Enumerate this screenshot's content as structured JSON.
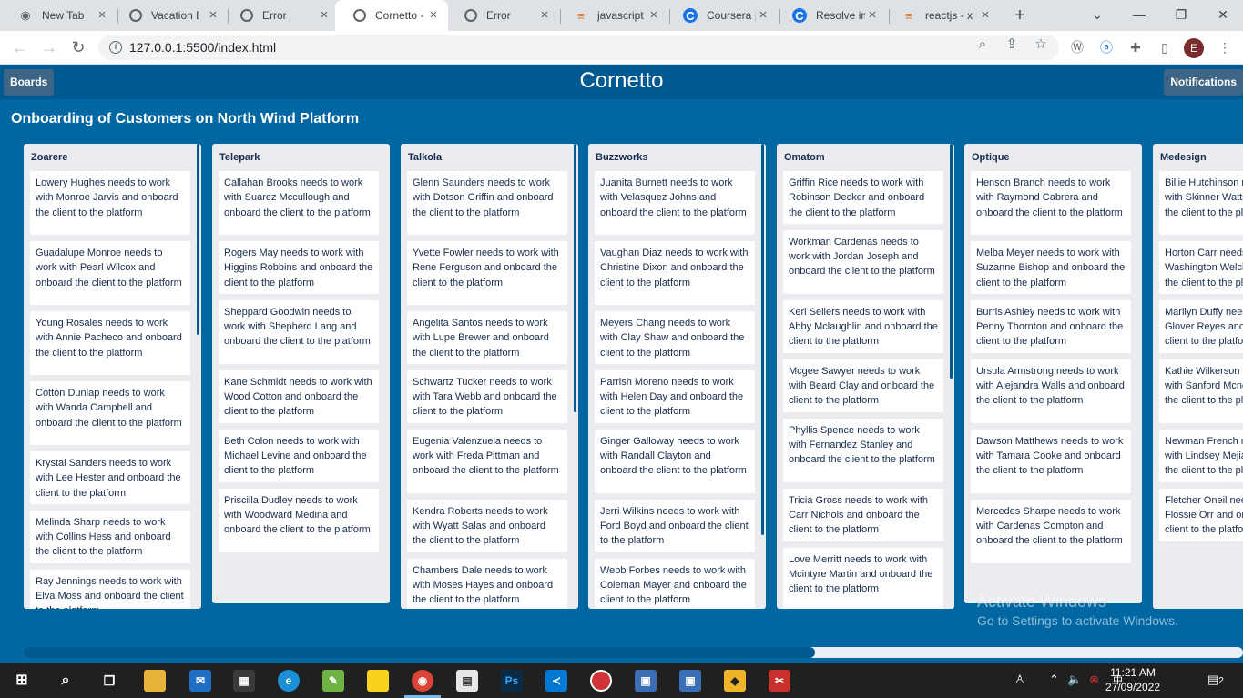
{
  "browser": {
    "tabs": [
      {
        "label": "New Tab",
        "favicon": "chrome-icon"
      },
      {
        "label": "Vacation D",
        "favicon": "globe-icon"
      },
      {
        "label": "Error",
        "favicon": "globe-icon"
      },
      {
        "label": "Cornetto -",
        "favicon": "globe-icon"
      },
      {
        "label": "Error",
        "favicon": "globe-icon"
      },
      {
        "label": "javascript -",
        "favicon": "stackoverflow-icon"
      },
      {
        "label": "Coursera |",
        "favicon": "coursera-icon"
      },
      {
        "label": "Resolve im",
        "favicon": "coursera-icon"
      },
      {
        "label": "reactjs - x",
        "favicon": "stackoverflow-icon"
      }
    ],
    "url": "127.0.0.1:5500/index.html",
    "profile_initial": "E"
  },
  "app": {
    "title": "Cornetto",
    "boards_button": "Boards",
    "notifications_button": "Notifications",
    "board_title": "Onboarding of Customers on North Wind Platform",
    "lists": [
      {
        "title": "Zoarere",
        "cards": [
          "Lowery Hughes needs to work with Monroe Jarvis and onboard the client to the platform",
          "Guadalupe Monroe needs to work with Pearl Wilcox and onboard the client to the platform",
          "Young Rosales needs to work with Annie Pacheco and onboard the client to the platform",
          "Cotton Dunlap needs to work with Wanda Campbell and onboard the client to the platform",
          "Krystal Sanders needs to work with Lee Hester and onboard the client to the platform",
          "Melinda Sharp needs to work with Collins Hess and onboard the client to the platform",
          "Ray Jennings needs to work with Elva Moss and onboard the client to the platform"
        ]
      },
      {
        "title": "Telepark",
        "cards": [
          "Callahan Brooks needs to work with Suarez Mccullough and onboard the client to the platform",
          "Rogers May needs to work with Higgins Robbins and onboard the client to the platform",
          "Sheppard Goodwin needs to work with Shepherd Lang and onboard the client to the platform",
          "Kane Schmidt needs to work with Wood Cotton and onboard the client to the platform",
          "Beth Colon needs to work with Michael Levine and onboard the client to the platform",
          "Priscilla Dudley needs to work with Woodward Medina and onboard the client to the platform"
        ]
      },
      {
        "title": "Talkola",
        "cards": [
          "Glenn Saunders needs to work with Dotson Griffin and onboard the client to the platform",
          "Yvette Fowler needs to work with Rene Ferguson and onboard the client to the platform",
          "Angelita Santos needs to work with Lupe Brewer and onboard the client to the platform",
          "Schwartz Tucker needs to work with Tara Webb and onboard the client to the platform",
          "Eugenia Valenzuela needs to work with Freda Pittman and onboard the client to the platform",
          "Kendra Roberts needs to work with Wyatt Salas and onboard the client to the platform",
          "Chambers Dale needs to work with Moses Hayes and onboard the client to the platform"
        ]
      },
      {
        "title": "Buzzworks",
        "cards": [
          "Juanita Burnett needs to work with Velasquez Johns and onboard the client to the platform",
          "Vaughan Diaz needs to work with Christine Dixon and onboard the client to the platform",
          "Meyers Chang needs to work with Clay Shaw and onboard the client to the platform",
          "Parrish Moreno needs to work with Helen Day and onboard the client to the platform",
          "Ginger Galloway needs to work with Randall Clayton and onboard the client to the platform",
          "Jerri Wilkins needs to work with Ford Boyd and onboard the client to the platform",
          "Webb Forbes needs to work with Coleman Mayer and onboard the client to the platform"
        ]
      },
      {
        "title": "Omatom",
        "cards": [
          "Griffin Rice needs to work with Robinson Decker and onboard the client to the platform",
          "Workman Cardenas needs to work with Jordan Joseph and onboard the client to the platform",
          "Keri Sellers needs to work with Abby Mclaughlin and onboard the client to the platform",
          "Mcgee Sawyer needs to work with Beard Clay and onboard the client to the platform",
          "Phyllis Spence needs to work with Fernandez Stanley and onboard the client to the platform",
          "Tricia Gross needs to work with Carr Nichols and onboard the client to the platform",
          "Love Merritt needs to work with Mcintyre Martin and onboard the client to the platform"
        ]
      },
      {
        "title": "Optique",
        "cards": [
          "Henson Branch needs to work with Raymond Cabrera and onboard the client to the platform",
          "Melba Meyer needs to work with Suzanne Bishop and onboard the client to the platform",
          "Burris Ashley needs to work with Penny Thornton and onboard the client to the platform",
          "Ursula Armstrong needs to work with Alejandra Walls and onboard the client to the platform",
          "Dawson Matthews needs to work with Tamara Cooke and onboard the client to the platform",
          "Mercedes Sharpe needs to work with Cardenas Compton and onboard the client to the platform"
        ]
      },
      {
        "title": "Medesign",
        "cards": [
          "Billie Hutchinson needs to work with Skinner Watts and onboard the client to the platform",
          "Horton Carr needs to work with Washington Welch and onboard the client to the platform",
          "Marilyn Duffy needs to work with Glover Reyes and onboard the client to the platform",
          "Kathie Wilkerson needs to work with Sanford Mcneil and onboard the client to the platform",
          "Newman French needs to work with Lindsey Mejia and onboard the client to the platform",
          "Fletcher Oneil needs to work with Flossie Orr and onboard the client to the platform"
        ]
      }
    ]
  },
  "windows_watermark": {
    "line1": "Activate Windows",
    "line2": "Go to Settings to activate Windows."
  },
  "taskbar": {
    "time": "11:21 AM",
    "date": "27/09/2022",
    "notification_count": "2"
  }
}
